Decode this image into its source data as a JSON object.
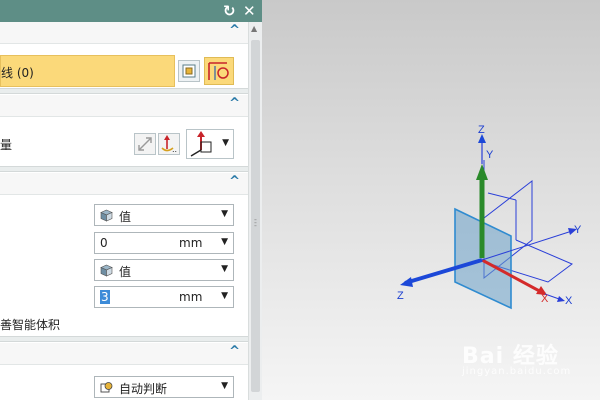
{
  "dialog": {
    "title_icons": [
      "reset-icon",
      "close-icon"
    ],
    "section1": {
      "selection_label": "线 (0)"
    },
    "section2": {
      "label": "量"
    },
    "section3": {
      "start_option": "值",
      "start_value": "0",
      "start_unit": "mm",
      "end_option": "值",
      "end_value": "3",
      "end_unit": "mm",
      "smart_volume_label": "善智能体积"
    },
    "section4": {
      "auto_option": "自动判断"
    }
  },
  "viewport": {
    "axis_labels": {
      "z_top": "Z",
      "y_top": "Y",
      "y_right": "Y",
      "z_left": "Z",
      "x_red": "X",
      "x_blue": "X"
    }
  },
  "watermark": {
    "text": "Bai 经验",
    "sub": "jingyan.baidu.com"
  },
  "colors": {
    "title_bar": "#5e8e86",
    "highlight": "#fbd97a",
    "axis_red": "#d42a2a",
    "axis_green": "#2a8a2a",
    "axis_blue": "#1c3fd0"
  }
}
